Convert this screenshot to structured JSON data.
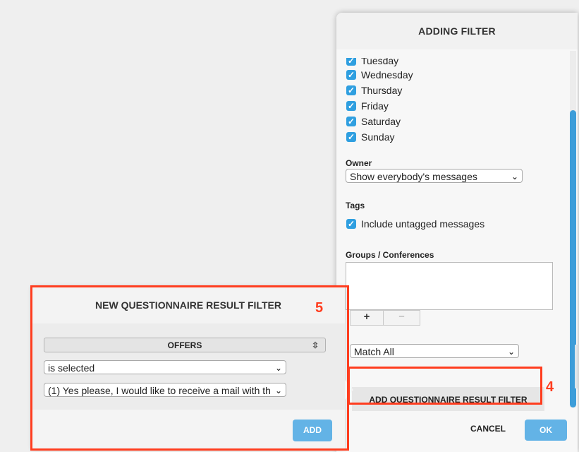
{
  "main_dialog": {
    "title": "ADDING FILTER",
    "partial_day": "Tuesday",
    "days": [
      "Wednesday",
      "Thursday",
      "Friday",
      "Saturday",
      "Sunday"
    ],
    "owner_label": "Owner",
    "owner_value": "Show everybody's messages",
    "tags_label": "Tags",
    "tags_option": "Include untagged messages",
    "groups_label": "Groups / Conferences",
    "plus": "+",
    "minus": "−",
    "match_value": "Match All",
    "add_qrf_label": "ADD QUESTIONNAIRE RESULT FILTER",
    "cancel": "CANCEL",
    "ok": "OK"
  },
  "popover": {
    "title": "NEW QUESTIONNAIRE RESULT FILTER",
    "question_value": "OFFERS",
    "operator_value": "is selected",
    "answer_value": "(1) Yes please, I would like to receive a mail with th",
    "add": "ADD"
  },
  "annotations": [
    "5",
    "4"
  ],
  "icons": {
    "checkbox": "check-icon",
    "select": "chevron-down-icon",
    "sorter": "updown-icon"
  },
  "colors": {
    "accent": "#2f9fe0",
    "button_blue": "#63b3e6",
    "annotation": "#ff3d1f"
  }
}
